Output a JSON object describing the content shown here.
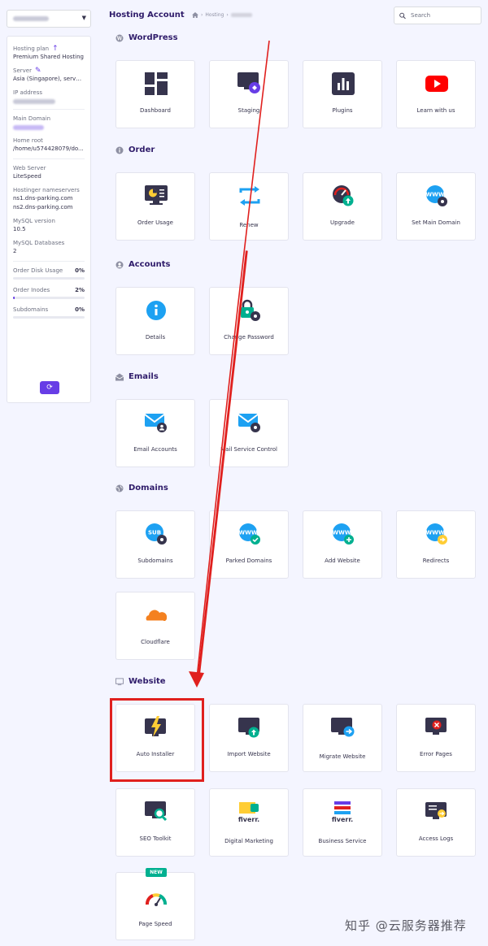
{
  "header": {
    "title": "Hosting Account",
    "breadcrumb_hosting": "Hosting",
    "search_placeholder": "Search"
  },
  "sidebar": {
    "hosting_plan_label": "Hosting plan",
    "hosting_plan_value": "Premium Shared Hosting",
    "server_label": "Server",
    "server_value": "Asia (Singapore), server...",
    "ip_label": "IP address",
    "main_domain_label": "Main Domain",
    "home_root_label": "Home root",
    "home_root_value": "/home/u574428079/do...",
    "web_server_label": "Web Server",
    "web_server_value": "LiteSpeed",
    "ns_label": "Hostinger nameservers",
    "ns1": "ns1.dns-parking.com",
    "ns2": "ns2.dns-parking.com",
    "mysql_version_label": "MySQL version",
    "mysql_version_value": "10.5",
    "mysql_db_label": "MySQL Databases",
    "mysql_db_value": "2",
    "usage": [
      {
        "label": "Order Disk Usage",
        "pct": "0%",
        "fraction": 0.0
      },
      {
        "label": "Order Inodes",
        "pct": "2%",
        "fraction": 0.02
      },
      {
        "label": "Subdomains",
        "pct": "0%",
        "fraction": 0.0
      }
    ]
  },
  "sections": {
    "wordpress": "WordPress",
    "order": "Order",
    "accounts": "Accounts",
    "emails": "Emails",
    "domains": "Domains",
    "website": "Website"
  },
  "tiles": {
    "dashboard": "Dashboard",
    "staging": "Staging",
    "plugins": "Plugins",
    "learn": "Learn with us",
    "order_usage": "Order Usage",
    "renew": "Renew",
    "upgrade": "Upgrade",
    "set_main_domain": "Set Main Domain",
    "details": "Details",
    "change_password": "Change Password",
    "email_accounts": "Email Accounts",
    "mail_service_control": "Mail Service Control",
    "subdomains": "Subdomains",
    "parked_domains": "Parked Domains",
    "add_website": "Add Website",
    "redirects": "Redirects",
    "cloudflare": "Cloudflare",
    "auto_installer": "Auto Installer",
    "import_website": "Import Website",
    "migrate_website": "Migrate Website",
    "error_pages": "Error Pages",
    "seo_toolkit": "SEO Toolkit",
    "digital_marketing": "Digital Marketing",
    "business_service": "Business Service",
    "access_logs": "Access Logs",
    "page_speed": "Page Speed",
    "new_badge": "NEW"
  },
  "icon_labels": {
    "www": "WWW",
    "sub": "SUB",
    "fiverr": "fiverr."
  },
  "watermark": "知乎 @云服务器推荐",
  "colors": {
    "accent": "#673de6",
    "annotation_red": "#e0201e",
    "success": "#00b090"
  }
}
